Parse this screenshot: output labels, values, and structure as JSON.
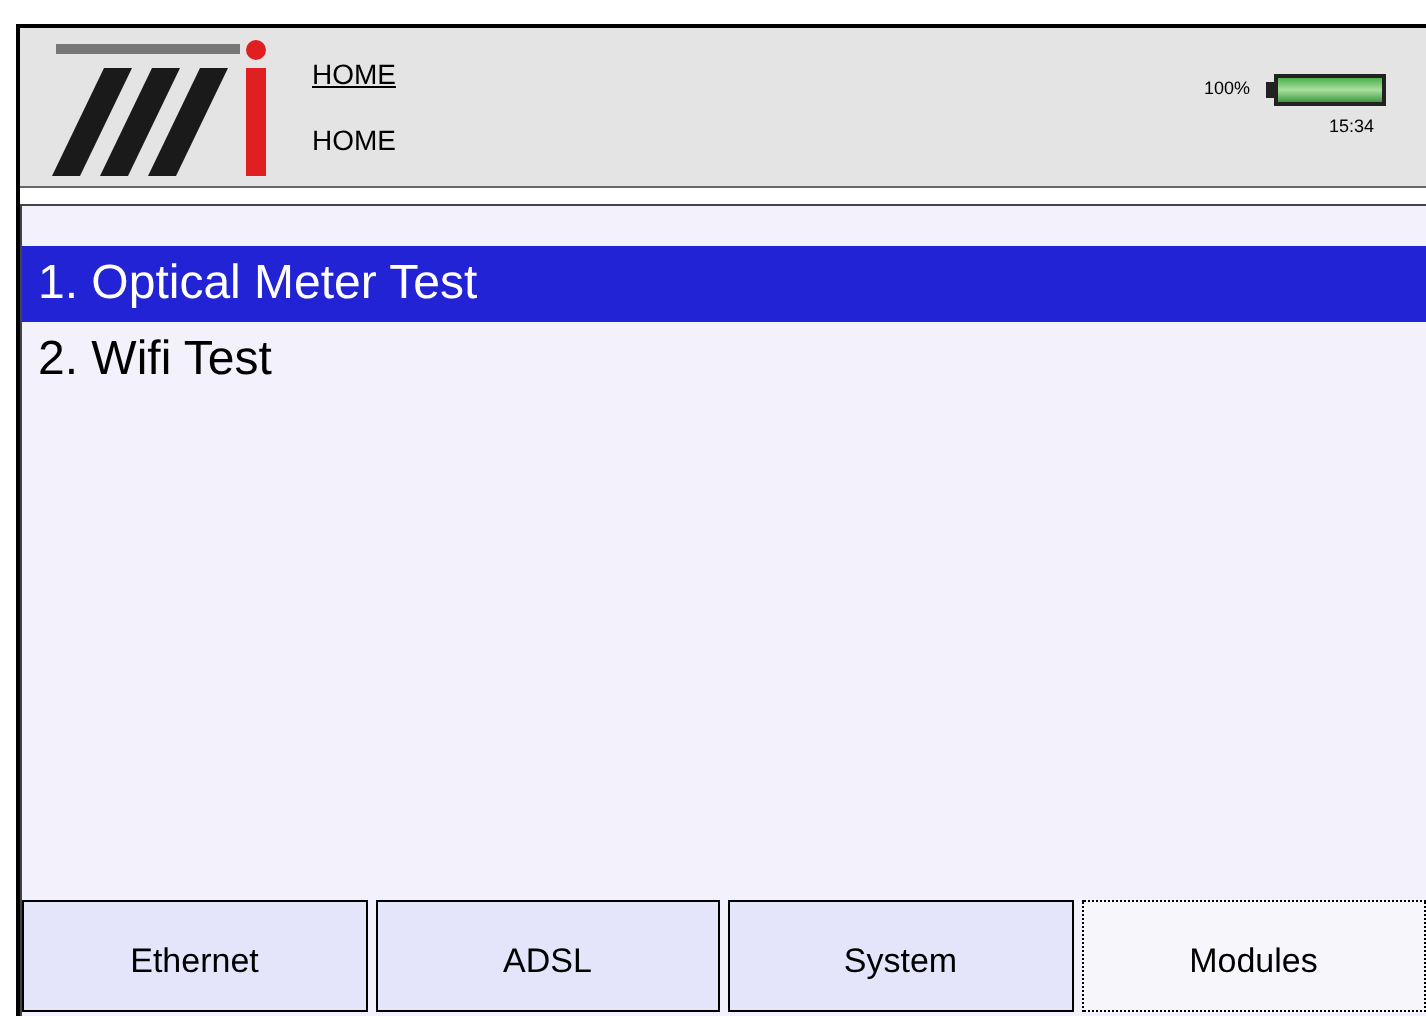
{
  "header": {
    "title": "HOME",
    "subtitle": "HOME",
    "battery": {
      "reading": "100%",
      "level": 1
    },
    "time": "15:34"
  },
  "menu": [
    {
      "label": "1. Optical Meter Test",
      "selected": true
    },
    {
      "label": "2. Wifi Test",
      "selected": false
    }
  ],
  "tabs": [
    {
      "label": "Ethernet",
      "selected": false
    },
    {
      "label": "ADSL",
      "selected": false
    },
    {
      "label": "System",
      "selected": false
    },
    {
      "label": "Modules",
      "selected": true
    }
  ]
}
